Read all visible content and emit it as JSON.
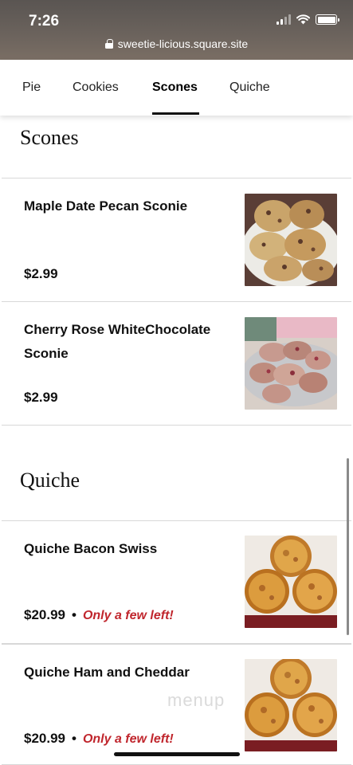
{
  "status_bar": {
    "time": "7:26",
    "url": "sweetie-licious.square.site"
  },
  "tabs": [
    {
      "label": "Pie",
      "active": false
    },
    {
      "label": "Cookies",
      "active": false
    },
    {
      "label": "Scones",
      "active": true
    },
    {
      "label": "Quiche",
      "active": false
    }
  ],
  "sections": {
    "scones": {
      "title": "Scones",
      "items": [
        {
          "name": "Maple Date Pecan Sconie",
          "price": "$2.99",
          "image_icon": "scones-photo"
        },
        {
          "name": "Cherry Rose WhiteChocolate Sconie",
          "price": "$2.99",
          "image_icon": "scones-photo"
        }
      ]
    },
    "quiche": {
      "title": "Quiche",
      "items": [
        {
          "name": "Quiche Bacon Swiss",
          "price": "$20.99",
          "stock_note": "Only a few left!",
          "image_icon": "quiche-photo"
        },
        {
          "name": "Quiche Ham and Cheddar",
          "price": "$20.99",
          "stock_note": "Only a few left!",
          "image_icon": "quiche-photo"
        }
      ]
    }
  },
  "watermark": "menup",
  "colors": {
    "accent_low_stock": "#c0262d",
    "active_tab_underline": "#111111"
  }
}
